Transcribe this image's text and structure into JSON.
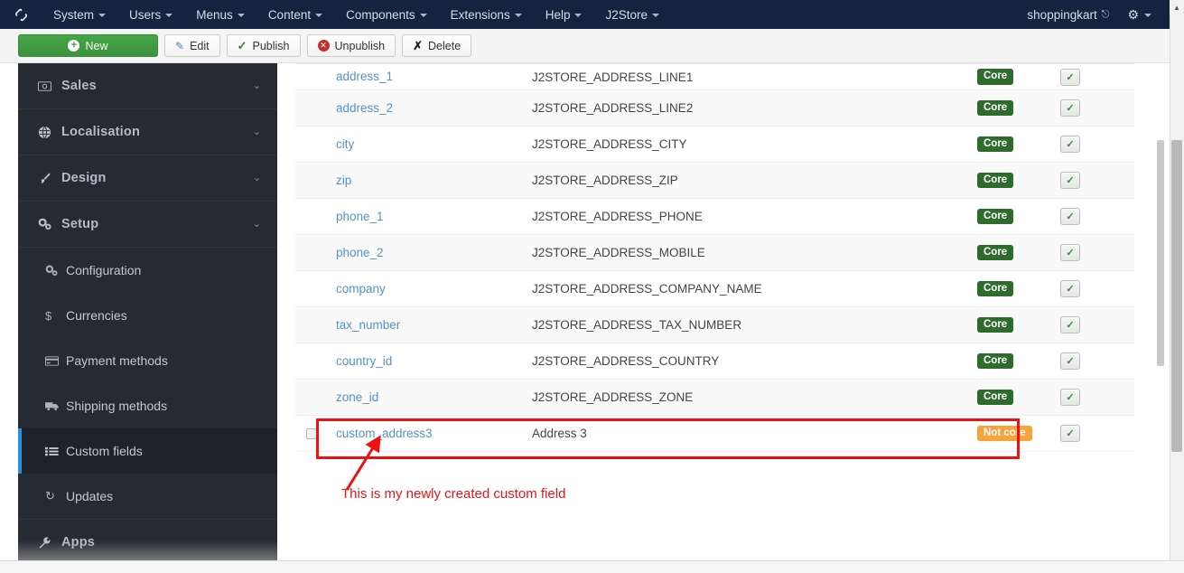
{
  "topbar": {
    "logo_icon": "joomla-logo-icon",
    "menu": [
      {
        "label": "System",
        "caret": true
      },
      {
        "label": "Users",
        "caret": true
      },
      {
        "label": "Menus",
        "caret": true
      },
      {
        "label": "Content",
        "caret": true
      },
      {
        "label": "Components",
        "caret": true
      },
      {
        "label": "Extensions",
        "caret": true
      },
      {
        "label": "Help",
        "caret": true
      },
      {
        "label": "J2Store",
        "caret": true
      }
    ],
    "site_name": "shoppingkart",
    "site_link_icon": "external-link-icon",
    "gear_icon": "gear-icon",
    "gear_caret_icon": "chevron-down-icon"
  },
  "toolbar": {
    "new_label": "New",
    "new_icon": "plus-circle-icon",
    "edit_label": "Edit",
    "edit_icon": "pencil-square-icon",
    "publish_label": "Publish",
    "publish_icon": "check-icon",
    "unpublish_label": "Unpublish",
    "unpublish_icon": "x-circle-icon",
    "delete_label": "Delete",
    "delete_icon": "x-icon"
  },
  "sidebar": {
    "groups": [
      {
        "label": "Sales",
        "icon": "money-icon",
        "glyph": "▣",
        "caret": "⌄"
      },
      {
        "label": "Localisation",
        "icon": "globe-icon",
        "glyph": "ἱ0",
        "caret": "⌄"
      },
      {
        "label": "Design",
        "icon": "brush-icon",
        "glyph": "✐",
        "caret": "⌄"
      },
      {
        "label": "Setup",
        "icon": "cogs-icon",
        "glyph": "⚙",
        "caret": "⌄"
      }
    ],
    "setup_items": [
      {
        "label": "Configuration",
        "icon": "cogs-icon",
        "glyph": "⚙",
        "active": false
      },
      {
        "label": "Currencies",
        "icon": "dollar-icon",
        "glyph": "$",
        "active": false
      },
      {
        "label": "Payment methods",
        "icon": "credit-card-icon",
        "glyph": "▭",
        "active": false
      },
      {
        "label": "Shipping methods",
        "icon": "truck-icon",
        "glyph": "Ὡa",
        "active": false
      },
      {
        "label": "Custom fields",
        "icon": "list-icon",
        "glyph": "≣",
        "active": true
      },
      {
        "label": "Updates",
        "icon": "refresh-icon",
        "glyph": "↻",
        "active": false
      }
    ],
    "apps_group": {
      "label": "Apps",
      "icon": "wrench-icon",
      "glyph": "⚒"
    }
  },
  "table": {
    "core_badge": "Core",
    "notcore_badge": "Not core",
    "publish_icon": "check-icon",
    "rows": [
      {
        "title": "address_1",
        "label": "J2STORE_ADDRESS_LINE1",
        "core": "Core",
        "core_type": "core",
        "checkbox": false,
        "published": true
      },
      {
        "title": "address_2",
        "label": "J2STORE_ADDRESS_LINE2",
        "core": "Core",
        "core_type": "core",
        "checkbox": false,
        "published": true
      },
      {
        "title": "city",
        "label": "J2STORE_ADDRESS_CITY",
        "core": "Core",
        "core_type": "core",
        "checkbox": false,
        "published": true
      },
      {
        "title": "zip",
        "label": "J2STORE_ADDRESS_ZIP",
        "core": "Core",
        "core_type": "core",
        "checkbox": false,
        "published": true
      },
      {
        "title": "phone_1",
        "label": "J2STORE_ADDRESS_PHONE",
        "core": "Core",
        "core_type": "core",
        "checkbox": false,
        "published": true
      },
      {
        "title": "phone_2",
        "label": "J2STORE_ADDRESS_MOBILE",
        "core": "Core",
        "core_type": "core",
        "checkbox": false,
        "published": true
      },
      {
        "title": "company",
        "label": "J2STORE_ADDRESS_COMPANY_NAME",
        "core": "Core",
        "core_type": "core",
        "checkbox": false,
        "published": true
      },
      {
        "title": "tax_number",
        "label": "J2STORE_ADDRESS_TAX_NUMBER",
        "core": "Core",
        "core_type": "core",
        "checkbox": false,
        "published": true
      },
      {
        "title": "country_id",
        "label": "J2STORE_ADDRESS_COUNTRY",
        "core": "Core",
        "core_type": "core",
        "checkbox": false,
        "published": true
      },
      {
        "title": "zone_id",
        "label": "J2STORE_ADDRESS_ZONE",
        "core": "Core",
        "core_type": "core",
        "checkbox": false,
        "published": true
      },
      {
        "title": "custom_address3",
        "label": "Address 3",
        "core": "Not core",
        "core_type": "notcore",
        "checkbox": true,
        "published": true
      }
    ]
  },
  "annotation": {
    "text": "This is my newly created custom field",
    "color": "#ee1111",
    "arrow_icon": "arrow-up-right-icon"
  }
}
